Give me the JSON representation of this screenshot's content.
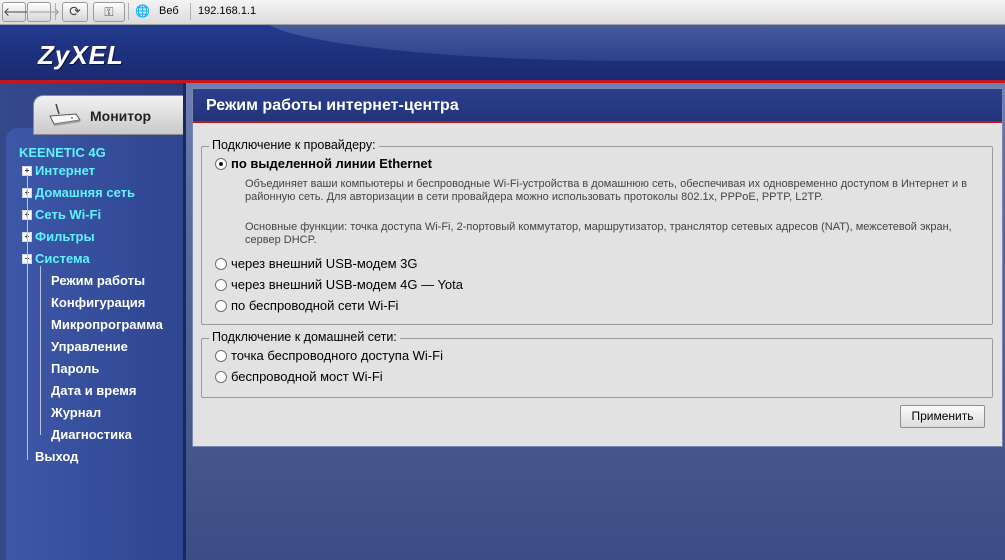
{
  "browser": {
    "back_glyph": "🡐",
    "forward_glyph": "🡒",
    "reload_glyph": "⟳",
    "key_glyph": "⚿",
    "globe_glyph": "🌐",
    "zone": "Веб",
    "address": "192.168.1.1"
  },
  "header": {
    "logo": "ZyXEL"
  },
  "sidebar": {
    "monitor_tab": "Монитор",
    "device": "KEENETIC 4G",
    "items": [
      {
        "label": "Интернет",
        "expand": "+"
      },
      {
        "label": "Домашняя сеть",
        "expand": "+"
      },
      {
        "label": "Сеть Wi-Fi",
        "expand": "+"
      },
      {
        "label": "Фильтры",
        "expand": "+"
      },
      {
        "label": "Система",
        "expand": "−"
      }
    ],
    "system_items": [
      "Режим работы",
      "Конфигурация",
      "Микропрограмма",
      "Управление",
      "Пароль",
      "Дата и время",
      "Журнал",
      "Диагностика"
    ],
    "exit": "Выход"
  },
  "main": {
    "title": "Режим работы интернет-центра",
    "provider_group": {
      "legend": "Подключение к провайдеру:",
      "options": [
        {
          "label": "по выделенной линии Ethernet",
          "checked": true
        },
        {
          "label": "через внешний USB-модем 3G",
          "checked": false
        },
        {
          "label": "через внешний USB-модем 4G — Yota",
          "checked": false
        },
        {
          "label": "по беспроводной сети Wi-Fi",
          "checked": false
        }
      ],
      "description_1": "Объединяет ваши компьютеры и беспроводные Wi-Fi-устройства в домашнюю сеть, обеспечивая их одновременно доступом в Интернет и в районную сеть. Для авторизации в сети провайдера можно использовать протоколы 802.1x, PPPoE, PPTP, L2TP.",
      "description_2": "Основные функции: точка доступа Wi-Fi, 2-портовый коммутатор, маршрутизатор, транслятор сетевых адресов (NAT), межсетевой экран, сервер DHCP."
    },
    "home_group": {
      "legend": "Подключение к домашней сети:",
      "options": [
        {
          "label": "точка беспроводного доступа Wi-Fi",
          "checked": false
        },
        {
          "label": "беспроводной мост Wi-Fi",
          "checked": false
        }
      ]
    },
    "apply_label": "Применить"
  },
  "colors": {
    "header_blue": "#1c2f7a",
    "accent_red": "#c4161c",
    "menu_cyan": "#5ff2ff"
  }
}
